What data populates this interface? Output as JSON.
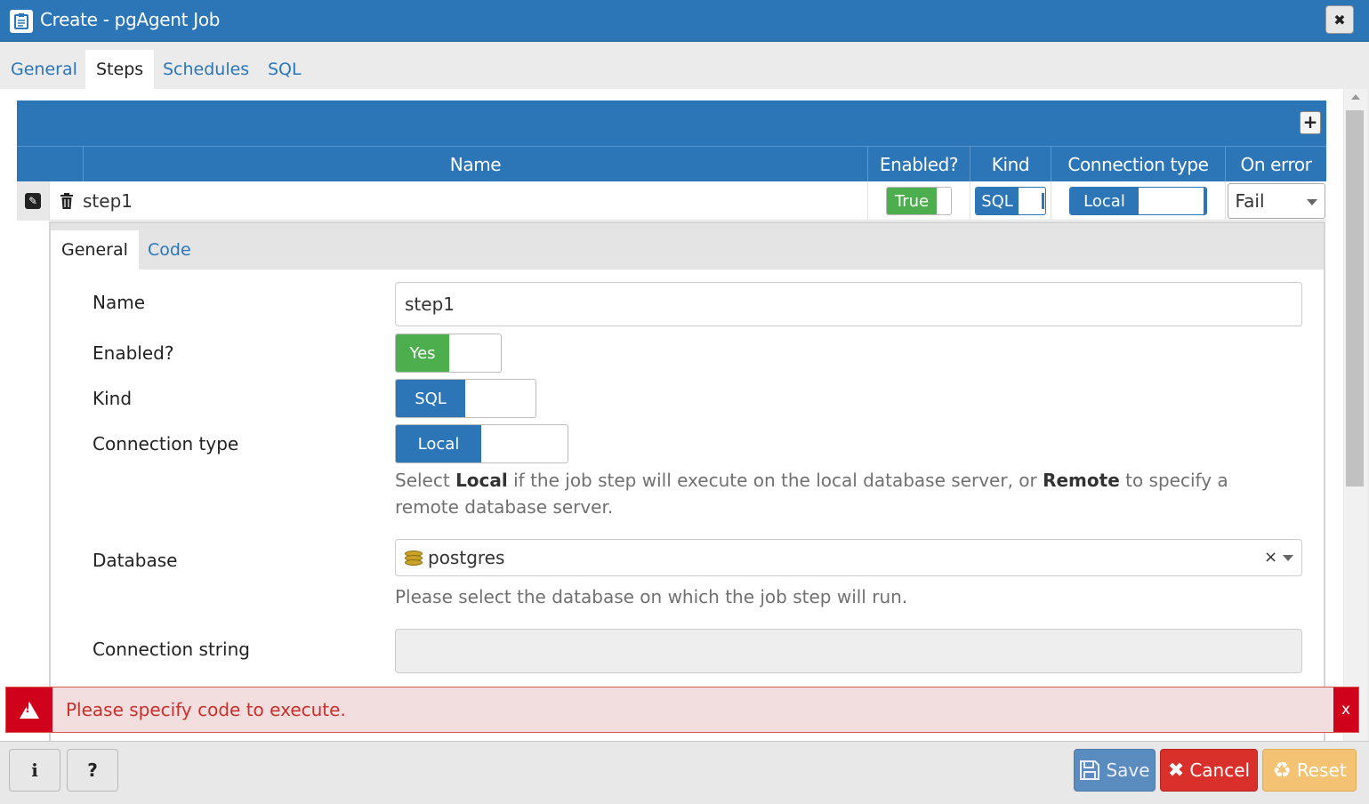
{
  "window": {
    "title": "Create - pgAgent Job",
    "close_label": "✖",
    "title_icon": "clipboard-icon"
  },
  "tabs": [
    {
      "label": "General",
      "active": false
    },
    {
      "label": "Steps",
      "active": true
    },
    {
      "label": "Schedules",
      "active": false
    },
    {
      "label": "SQL",
      "active": false
    }
  ],
  "grid": {
    "add_label": "+",
    "headers": {
      "name": "Name",
      "enabled": "Enabled?",
      "kind": "Kind",
      "connection_type": "Connection type",
      "on_error": "On error"
    },
    "rows": [
      {
        "name": "step1",
        "enabled": "True",
        "kind": "SQL",
        "connection_type": "Local",
        "on_error": "Fail"
      }
    ]
  },
  "detail": {
    "tabs": [
      {
        "label": "General",
        "active": true
      },
      {
        "label": "Code",
        "active": false
      }
    ],
    "fields": {
      "name_label": "Name",
      "name_value": "step1",
      "enabled_label": "Enabled?",
      "enabled_value": "Yes",
      "kind_label": "Kind",
      "kind_value": "SQL",
      "conn_label": "Connection type",
      "conn_value": "Local",
      "conn_help_1": "Select ",
      "conn_help_local": "Local",
      "conn_help_2": " if the job step will execute on the local database server, or ",
      "conn_help_remote": "Remote",
      "conn_help_3": " to specify a remote database server.",
      "database_label": "Database",
      "database_value": "postgres",
      "database_clear": "×",
      "database_help": "Please select the database on which the job step will run.",
      "connstr_label": "Connection string",
      "connstr_value": ""
    }
  },
  "alert": {
    "message": "Please specify code to execute.",
    "close_label": "x"
  },
  "footer": {
    "info_label": "i",
    "help_label": "?",
    "save_label": "Save",
    "cancel_label": "Cancel",
    "reset_label": "Reset"
  },
  "colors": {
    "primary": "#2c76b8",
    "success": "#4cae4c",
    "danger": "#d0021b",
    "warning": "#f3c373"
  }
}
